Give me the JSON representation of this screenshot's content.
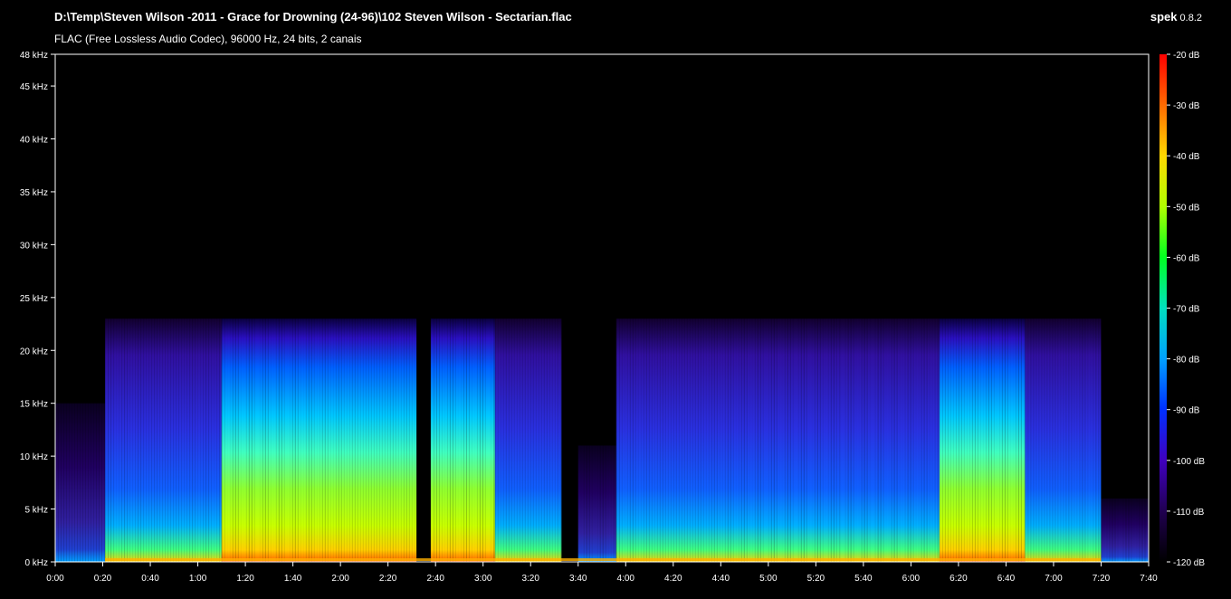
{
  "header": {
    "file_path": "D:\\Temp\\Steven Wilson -2011 - Grace for Drowning (24-96)\\102 Steven Wilson - Sectarian.flac",
    "file_info": "FLAC (Free Lossless Audio Codec), 96000 Hz, 24 bits, 2 canais",
    "app_name": "spek",
    "app_version": "0.8.2"
  },
  "chart_data": {
    "type": "heatmap",
    "x_ticks": [
      "0:00",
      "0:20",
      "0:40",
      "1:00",
      "1:20",
      "1:40",
      "2:00",
      "2:20",
      "2:40",
      "3:00",
      "3:20",
      "3:40",
      "4:00",
      "4:20",
      "4:40",
      "5:00",
      "5:20",
      "5:40",
      "6:00",
      "6:20",
      "6:40",
      "7:00",
      "7:20",
      "7:40"
    ],
    "x_range_seconds": [
      0,
      460
    ],
    "y_ticks": [
      "0 kHz",
      "5 kHz",
      "10 kHz",
      "15 kHz",
      "20 kHz",
      "25 kHz",
      "30 kHz",
      "35 kHz",
      "40 kHz",
      "45 kHz",
      "48 kHz"
    ],
    "y_tick_values_khz": [
      0,
      5,
      10,
      15,
      20,
      25,
      30,
      35,
      40,
      45,
      48
    ],
    "y_range_khz": [
      0,
      48
    ],
    "color_scale": {
      "ticks": [
        "-20 dB",
        "-30 dB",
        "-40 dB",
        "-50 dB",
        "-60 dB",
        "-70 dB",
        "-80 dB",
        "-90 dB",
        "-100 dB",
        "-110 dB",
        "-120 dB"
      ],
      "tick_values_db": [
        -20,
        -30,
        -40,
        -50,
        -60,
        -70,
        -80,
        -90,
        -100,
        -110,
        -120
      ],
      "range_db": [
        -120,
        -20
      ],
      "gradient_colors": [
        "#ff0000",
        "#ff6a00",
        "#ffd800",
        "#b0ff00",
        "#00ff20",
        "#00e0c0",
        "#00a0ff",
        "#0030ff",
        "#4000c0",
        "#200050",
        "#000000"
      ]
    },
    "segments": [
      {
        "start_s": 0,
        "end_s": 21,
        "top_khz": 15,
        "level": "low"
      },
      {
        "start_s": 21,
        "end_s": 70,
        "top_khz": 23,
        "level": "medium"
      },
      {
        "start_s": 70,
        "end_s": 152,
        "top_khz": 23,
        "level": "high"
      },
      {
        "start_s": 152,
        "end_s": 158,
        "top_khz": 23,
        "level": "gap"
      },
      {
        "start_s": 158,
        "end_s": 185,
        "top_khz": 23,
        "level": "high"
      },
      {
        "start_s": 185,
        "end_s": 213,
        "top_khz": 23,
        "level": "medium"
      },
      {
        "start_s": 213,
        "end_s": 220,
        "top_khz": 0,
        "level": "silent"
      },
      {
        "start_s": 220,
        "end_s": 236,
        "top_khz": 11,
        "level": "low"
      },
      {
        "start_s": 236,
        "end_s": 330,
        "top_khz": 23,
        "level": "medium"
      },
      {
        "start_s": 330,
        "end_s": 372,
        "top_khz": 23,
        "level": "medium"
      },
      {
        "start_s": 372,
        "end_s": 408,
        "top_khz": 23,
        "level": "high"
      },
      {
        "start_s": 408,
        "end_s": 440,
        "top_khz": 23,
        "level": "medium"
      },
      {
        "start_s": 440,
        "end_s": 460,
        "top_khz": 6,
        "level": "low"
      }
    ]
  }
}
